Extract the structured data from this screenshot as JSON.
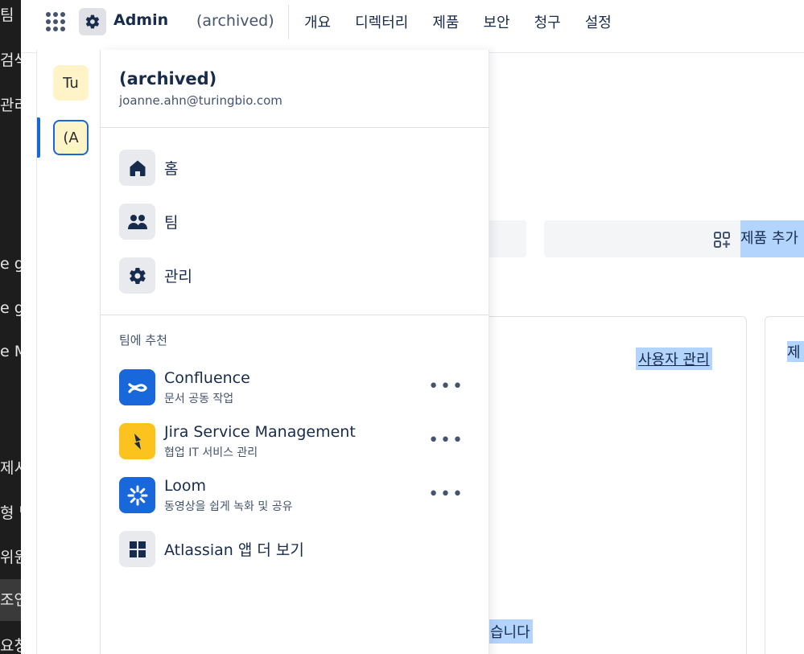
{
  "background_strip": {
    "fragments": [
      "팀",
      "검색",
      "관리",
      "e g",
      "e g",
      "e M",
      "제시",
      "형 남",
      "위원",
      "조언",
      "요청"
    ]
  },
  "topbar": {
    "app_label": "Admin",
    "org_label": "(archived)",
    "nav": [
      "개요",
      "디렉터리",
      "제품",
      "보안",
      "청구",
      "설정"
    ]
  },
  "background_content": {
    "add_product_label": "제품 추가",
    "user_management_link": "사용자 관리",
    "card2_fragment": "제",
    "bottom_fragment": "습니다"
  },
  "switcher": {
    "orgs": [
      {
        "initials": "Tu"
      },
      {
        "initials": "(A"
      }
    ]
  },
  "panel": {
    "title": "(archived)",
    "email": "joanne.ahn@turingbio.com",
    "menu": [
      {
        "label": "홈",
        "icon": "home-icon"
      },
      {
        "label": "팀",
        "icon": "people-icon"
      },
      {
        "label": "관리",
        "icon": "gear-icon"
      }
    ],
    "recommended_title": "팀에 추천",
    "apps": [
      {
        "name": "Confluence",
        "desc": "문서 공동 작업",
        "color": "#1868db"
      },
      {
        "name": "Jira Service Management",
        "desc": "협업 IT 서비스 관리",
        "color": "#fcc21d"
      },
      {
        "name": "Loom",
        "desc": "동영상을 쉽게 녹화 및 공유",
        "color": "#1868db"
      }
    ],
    "more_apps_label": "Atlassian 앱 더 보기",
    "more_glyph": "•••"
  }
}
